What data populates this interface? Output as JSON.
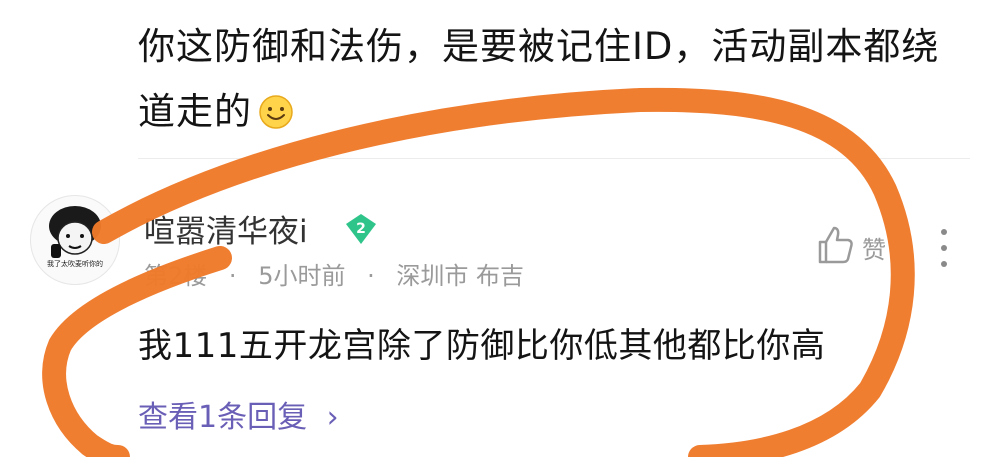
{
  "previous_comment": {
    "text": "你这防御和法伤，是要被记住ID，活动副本都绕道走的"
  },
  "comment": {
    "username": "喧嚣清华夜i",
    "level": "2",
    "floor": "第2楼",
    "time": "5小时前",
    "location": "深圳市 布吉",
    "like_count": "赞",
    "text": "我111五开龙宫除了防御比你低其他都比你高",
    "reply_link": "查看1条回复",
    "avatar_caption": "我了太吹麦听你的"
  },
  "colors": {
    "accent": "#6a5fb6",
    "level_badge": "#2fc48a",
    "annotation": "#f07a2a"
  }
}
